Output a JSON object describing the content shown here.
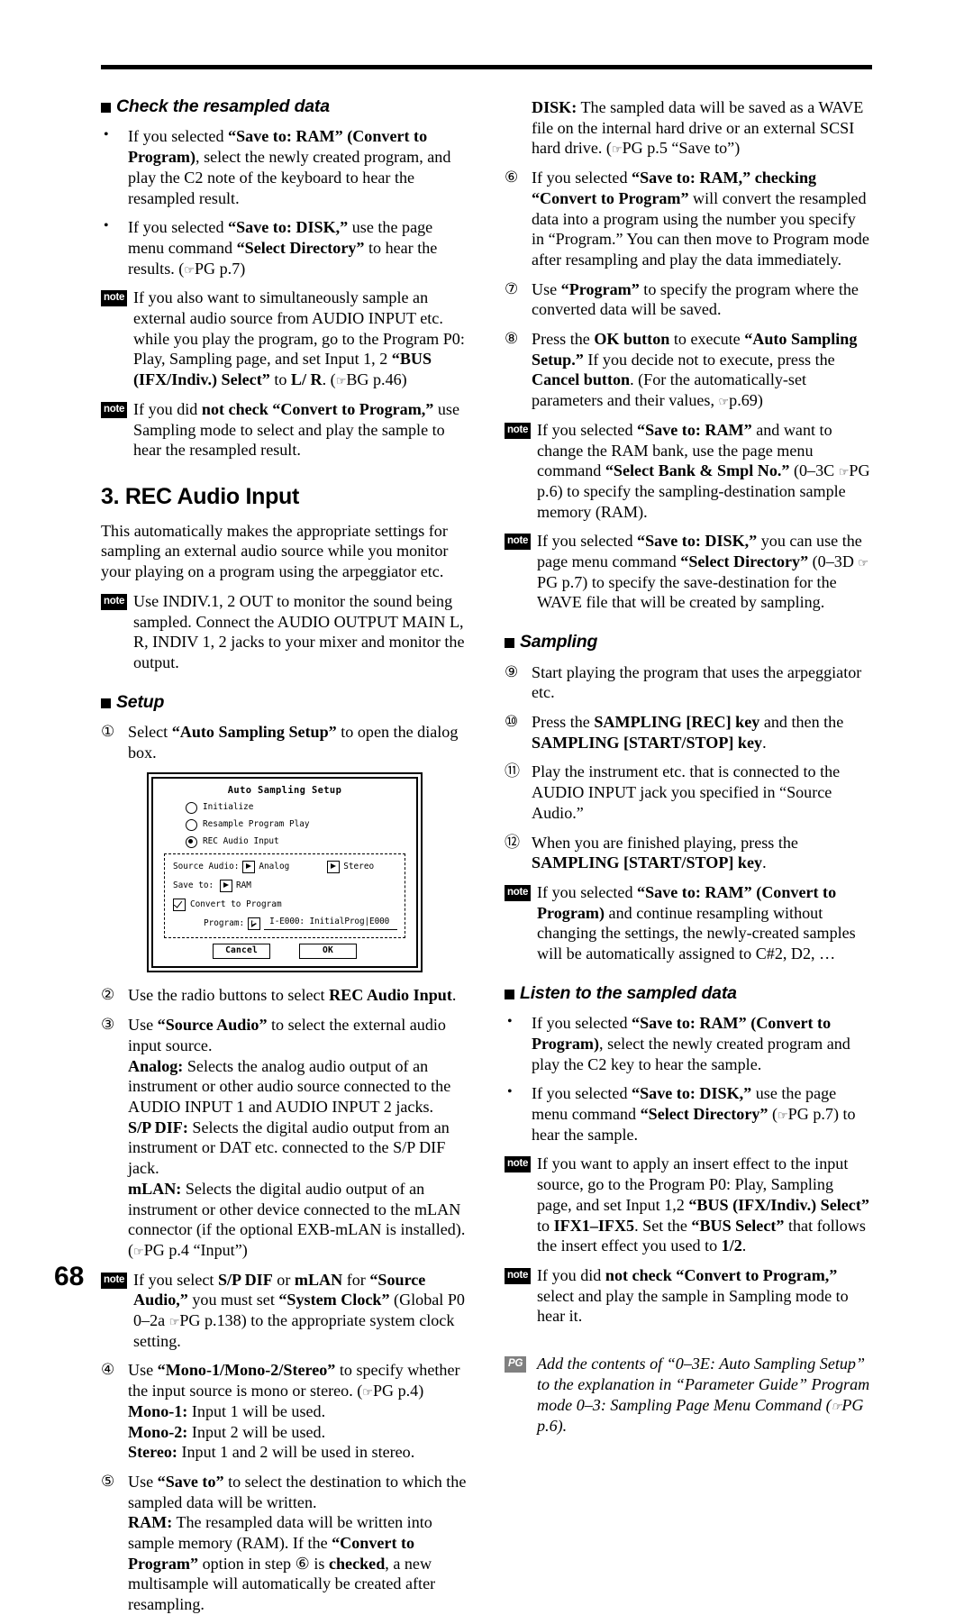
{
  "page_number": "68",
  "left_column": {
    "heading_check": "Check the resampled data",
    "bullets": [
      {
        "marker": "•",
        "html": "If you selected <b>&ldquo;Save to: RAM&rdquo; (Convert to Program)</b>, select the newly created program, and play the C2 note of the keyboard to hear the resampled result."
      },
      {
        "marker": "•",
        "html": "If you selected <b>&ldquo;Save to: DISK,&rdquo;</b> use the page menu command <b>&ldquo;Select Directory&rdquo;</b> to hear the results. (<span class=\"hand\">&#9758;</span>PG p.7)"
      }
    ],
    "notes_top": [
      {
        "badge": "note",
        "html": "If you also want to simultaneously sample an external audio source from AUDIO INPUT etc. while you play the program, go to the Program P0: Play, Sampling page, and set Input 1, 2 <b>&ldquo;BUS (IFX/Indiv.) Select&rdquo;</b> to <b>L/ R</b>. (<span class=\"hand\">&#9758;</span>BG p.46)"
      },
      {
        "badge": "note",
        "html": "If you did <b>not check &ldquo;Convert to Program,&rdquo;</b> use Sampling mode to select and play the sample to hear the resampled result."
      }
    ],
    "main_heading": "3. REC Audio Input",
    "intro_paragraph": "This automatically makes the appropriate settings for sampling an external audio source while you monitor your playing on a program using the arpeggiator etc.",
    "note_indiv": {
      "badge": "note",
      "html": "Use INDIV.1, 2 OUT to monitor the sound being sampled. Connect the AUDIO OUTPUT MAIN L, R, INDIV 1, 2 jacks to your mixer and monitor the output."
    },
    "heading_setup": "Setup",
    "step_1": {
      "marker": "①",
      "html": "Select <b>&ldquo;Auto Sampling Setup&rdquo;</b> to open the dialog box."
    },
    "steps_after_figure": [
      {
        "marker": "②",
        "html": "Use the radio buttons to select <b>REC Audio Input</b>."
      },
      {
        "marker": "③",
        "html": "Use <b>&ldquo;Source Audio&rdquo;</b> to select the external audio input source.<span class=\"indent-sub\"><b>Analog:</b> Selects the analog audio output of an instrument or other audio source connected to the AUDIO INPUT 1 and AUDIO INPUT 2 jacks.</span><span class=\"indent-sub\"><b>S/P DIF:</b> Selects the digital audio output from an instrument or DAT etc. connected to the S/P DIF jack.</span><span class=\"indent-sub\"><b>mLAN:</b> Selects the digital audio output of an instrument or other device connected to the mLAN connector (if the optional EXB-mLAN is installed). (<span class=\"hand\">&#9758;</span>PG p.4 &ldquo;Input&rdquo;)</span>"
      }
    ],
    "note_clock": {
      "badge": "note",
      "html": "If you select <b>S/P DIF</b> or <b>mLAN</b> for <b>&ldquo;Source Audio,&rdquo;</b> you must set <b>&ldquo;System Clock&rdquo;</b> (Global P0 0&ndash;2a <span class=\"hand\">&#9758;</span>PG p.138) to the appropriate system clock setting."
    },
    "steps_tail": [
      {
        "marker": "④",
        "html": "Use <b>&ldquo;Mono-1/Mono-2/Stereo&rdquo;</b> to specify whether the input source is mono or stereo. (<span class=\"hand\">&#9758;</span>PG p.4)<span class=\"indent-sub\"><b>Mono-1:</b> Input 1 will be used.</span><span class=\"indent-sub\"><b>Mono-2:</b> Input 2 will be used.</span><span class=\"indent-sub\"><b>Stereo:</b> Input 1 and 2 will be used in stereo.</span>"
      },
      {
        "marker": "⑤",
        "html": "Use <b>&ldquo;Save to&rdquo;</b> to select the destination to which the sampled data will be written.<span class=\"indent-sub\"><b>RAM:</b> The resampled data will be written into sample memory (RAM). If the <b>&ldquo;Convert to Program&rdquo;</b> option in step ⑥ is <b>checked</b>, a new multisample will automatically be created after resampling.</span>"
      }
    ]
  },
  "figure": {
    "name": "auto-sampling-setup-dialog",
    "title": "Auto Sampling Setup",
    "radio_options": [
      {
        "label": "Initialize",
        "selected": false
      },
      {
        "label": "Resample Program Play",
        "selected": false
      },
      {
        "label": "REC Audio Input",
        "selected": true
      }
    ],
    "source_audio_label": "Source Audio:",
    "source_audio_value": "Analog",
    "channel_value": "Stereo",
    "save_to_label": "Save to:",
    "save_to_value": "RAM",
    "convert_checkbox_label": "Convert to Program",
    "convert_checked": true,
    "program_label": "Program:",
    "program_value": "I-E000: InitialProg|E000",
    "cancel_button": "Cancel",
    "ok_button": "OK"
  },
  "right_column": {
    "disk_paragraph": {
      "html": "<b>DISK:</b> The sampled data will be saved as a WAVE file on the internal hard drive or an external SCSI hard drive. (<span class=\"hand\">&#9758;</span>PG p.5 &ldquo;Save to&rdquo;)"
    },
    "steps": [
      {
        "marker": "⑥",
        "html": "If you selected <b>&ldquo;Save to: RAM,&rdquo; checking &ldquo;Convert to Program&rdquo;</b> will convert the resampled data into a program using the number you specify in &ldquo;Program.&rdquo; You can then move to Program mode after resampling and play the data immediately."
      },
      {
        "marker": "⑦",
        "html": "Use <b>&ldquo;Program&rdquo;</b> to specify the program where the converted data will be saved."
      },
      {
        "marker": "⑧",
        "html": "Press the <b>OK button</b> to execute <b>&ldquo;Auto Sampling Setup.&rdquo;</b> If you decide not to execute, press the <b>Cancel button</b>. (For the automatically-set parameters and their values, <span class=\"hand\">&#9758;</span>p.69)"
      }
    ],
    "notes_mid": [
      {
        "badge": "note",
        "html": "If you selected <b>&ldquo;Save to: RAM&rdquo;</b> and want to change the RAM bank, use the page menu command <b>&ldquo;Select Bank &amp; Smpl No.&rdquo;</b> (0&ndash;3C <span class=\"hand\">&#9758;</span>PG p.6) to specify the sampling-destination sample memory (RAM)."
      },
      {
        "badge": "note",
        "html": "If you selected <b>&ldquo;Save to: DISK,&rdquo;</b> you can use the page menu command <b>&ldquo;Select Directory&rdquo;</b> (0&ndash;3D <span class=\"hand\">&#9758;</span>PG p.7) to specify the save-destination for the WAVE file that will be created by sampling."
      }
    ],
    "heading_sampling": "Sampling",
    "sampling_steps": [
      {
        "marker": "⑨",
        "html": "Start playing the program that uses the arpeggiator etc."
      },
      {
        "marker": "⑩",
        "html": "Press the <b>SAMPLING [REC] key</b> and then the <b>SAMPLING [START/STOP] key</b>."
      },
      {
        "marker": "⑪",
        "html": "Play the instrument etc. that is connected to the AUDIO INPUT jack you specified in &ldquo;Source Audio.&rdquo;"
      },
      {
        "marker": "⑫",
        "html": "When you are finished playing, press the <b>SAMPLING [START/STOP] key</b>."
      }
    ],
    "note_assigned": {
      "badge": "note",
      "html": "If you selected <b>&ldquo;Save to: RAM&rdquo; (Convert to Program)</b> and continue resampling without changing the settings, the newly-created samples will be automatically assigned to C#2, D2, &hellip;"
    },
    "heading_listen": "Listen to the sampled data",
    "listen_bullets": [
      {
        "marker": "•",
        "html": "If you selected <b>&ldquo;Save to: RAM&rdquo; (Convert to Program)</b>, select the newly created program and play the C2 key to hear the sample."
      },
      {
        "marker": "•",
        "html": "If you selected <b>&ldquo;Save to: DISK,&rdquo;</b> use the page menu command <b>&ldquo;Select Directory&rdquo;</b> (<span class=\"hand\">&#9758;</span>PG p.7) to hear the sample."
      }
    ],
    "notes_bottom": [
      {
        "badge": "note",
        "html": "If you want to apply an insert effect to the input source, go to the Program P0: Play, Sampling page, and set Input 1,2 <b>&ldquo;BUS (IFX/Indiv.) Select&rdquo;</b> to <b>IFX1&ndash;IFX5</b>. Set the <b>&ldquo;BUS Select&rdquo;</b> that follows the insert effect you used to <b>1/2</b>."
      },
      {
        "badge": "note",
        "html": "If you did <b>not check &ldquo;Convert to Program,&rdquo;</b> select and play the sample in Sampling mode to hear it."
      }
    ],
    "pg_note": {
      "badge": "PG",
      "html": "Add the contents of &ldquo;0&ndash;3E: Auto Sampling Setup&rdquo; to the explanation in &ldquo;Parameter Guide&rdquo; Program mode 0&ndash;3: Sampling Page Menu Command (<span class=\"hand\">&#9758;</span>PG p.6)."
    }
  }
}
